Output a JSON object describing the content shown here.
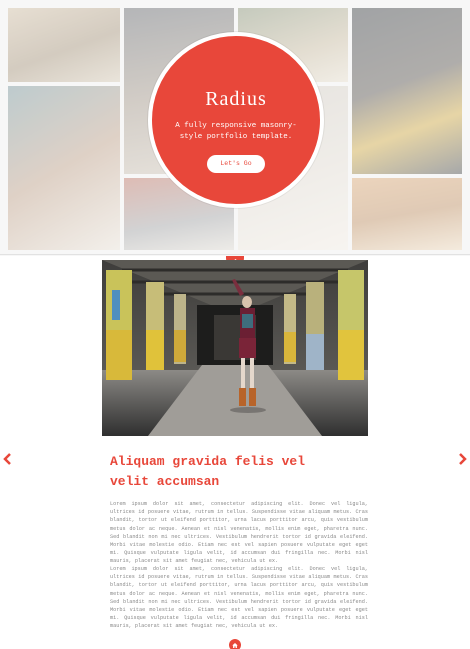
{
  "hero": {
    "title": "Radius",
    "subtitle": "A fully responsive masonry-style portfolio template.",
    "cta_label": "Let's Go"
  },
  "nav": {
    "home_icon": "home-icon",
    "prev_icon": "chevron-left-icon",
    "next_icon": "chevron-right-icon"
  },
  "article": {
    "title": "Aliquam gravida felis vel velit accumsan",
    "paragraphs": [
      "Lorem ipsum dolor sit amet, consectetur adipiscing elit. Donec vel ligula, ultrices id posuere vitae, rutrum in tellus. Suspendisse vitae aliquam metus. Cras blandit, tortor ut eleifend porttitor, urna lacus porttitor arcu, quis vestibulum metus dolor ac neque. Aenean et nisl venenatis, mollis enim eget, pharetra nunc. Sed blandit non mi nec ultrices. Vestibulum hendrerit tortor id gravida eleifend. Morbi vitae molestie odio. Etiam nec est vel sapien posuere vulputate eget eget mi. Quisque vulputate ligula velit, id accumsan dui fringilla nec. Morbi nisl mauris, placerat sit amet feugiat nec, vehicula ut ex.",
      "Lorem ipsum dolor sit amet, consectetur adipiscing elit. Donec vel ligula, ultrices id posuere vitae, rutrum in tellus. Suspendisse vitae aliquam metus. Cras blandit, tortor ut eleifend porttitor, urna lacus porttitor arcu, quis vestibulum metus dolor ac neque. Aenean et nisl venenatis, mollis enim eget, pharetra nunc. Sed blandit non mi nec ultrices. Vestibulum hendrerit tortor id gravida eleifend. Morbi vitae molestie odio. Etiam nec est vel sapien posuere vulputate eget eget mi. Quisque vulputate ligula velit, id accumsan dui fringilla nec. Morbi nisl mauris, placerat sit amet feugiat nec, vehicula ut ex."
    ]
  },
  "colors": {
    "accent": "#e8473a",
    "text_muted": "#8a8a8a",
    "background": "#ffffff"
  }
}
